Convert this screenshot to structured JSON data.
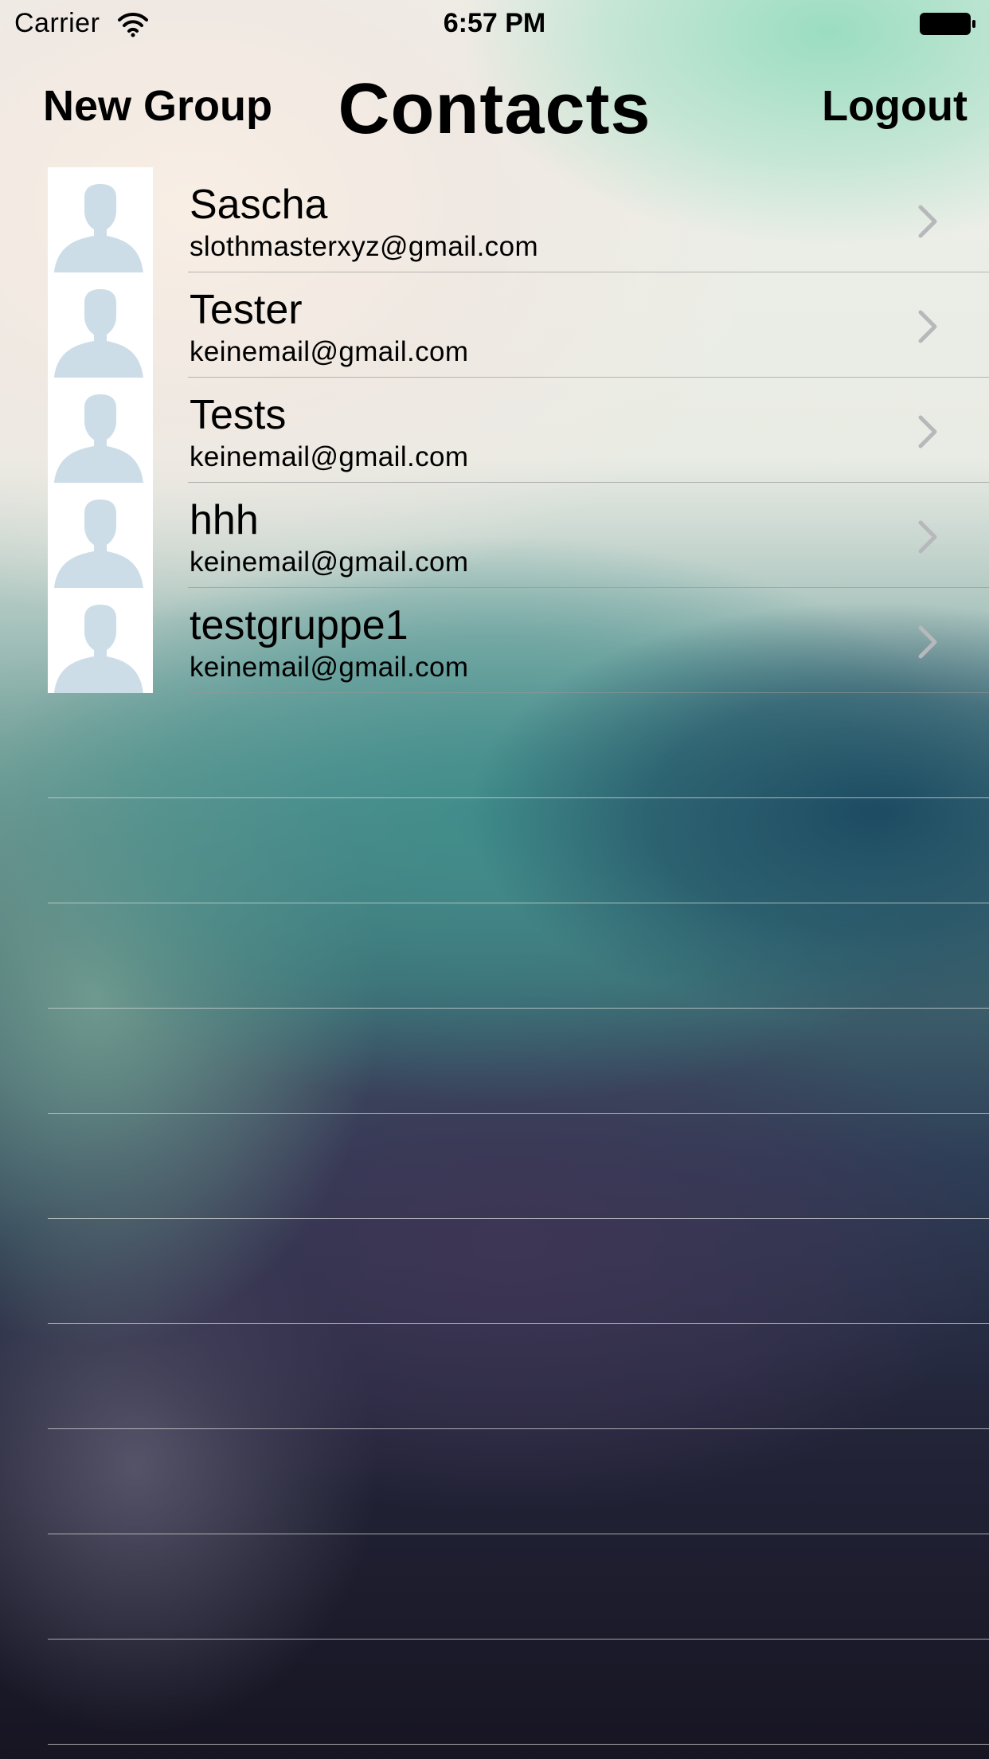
{
  "status_bar": {
    "carrier": "Carrier",
    "time": "6:57 PM",
    "icons": [
      "wifi-icon",
      "battery-icon"
    ]
  },
  "nav_bar": {
    "left_button": "New Group",
    "title": "Contacts",
    "right_button": "Logout"
  },
  "contacts": [
    {
      "name": "Sascha",
      "email": "slothmasterxyz@gmail.com",
      "icon": "avatar-placeholder-icon"
    },
    {
      "name": "Tester",
      "email": "keinemail@gmail.com",
      "icon": "avatar-placeholder-icon"
    },
    {
      "name": "Tests",
      "email": "keinemail@gmail.com",
      "icon": "avatar-placeholder-icon"
    },
    {
      "name": "hhh",
      "email": "keinemail@gmail.com",
      "icon": "avatar-placeholder-icon"
    },
    {
      "name": "testgruppe1",
      "email": "keinemail@gmail.com",
      "icon": "avatar-placeholder-icon"
    }
  ],
  "colors": {
    "avatar_silhouette": "#cddde8",
    "chevron": "#b7b7bc",
    "separator": "#c8c8c8"
  }
}
